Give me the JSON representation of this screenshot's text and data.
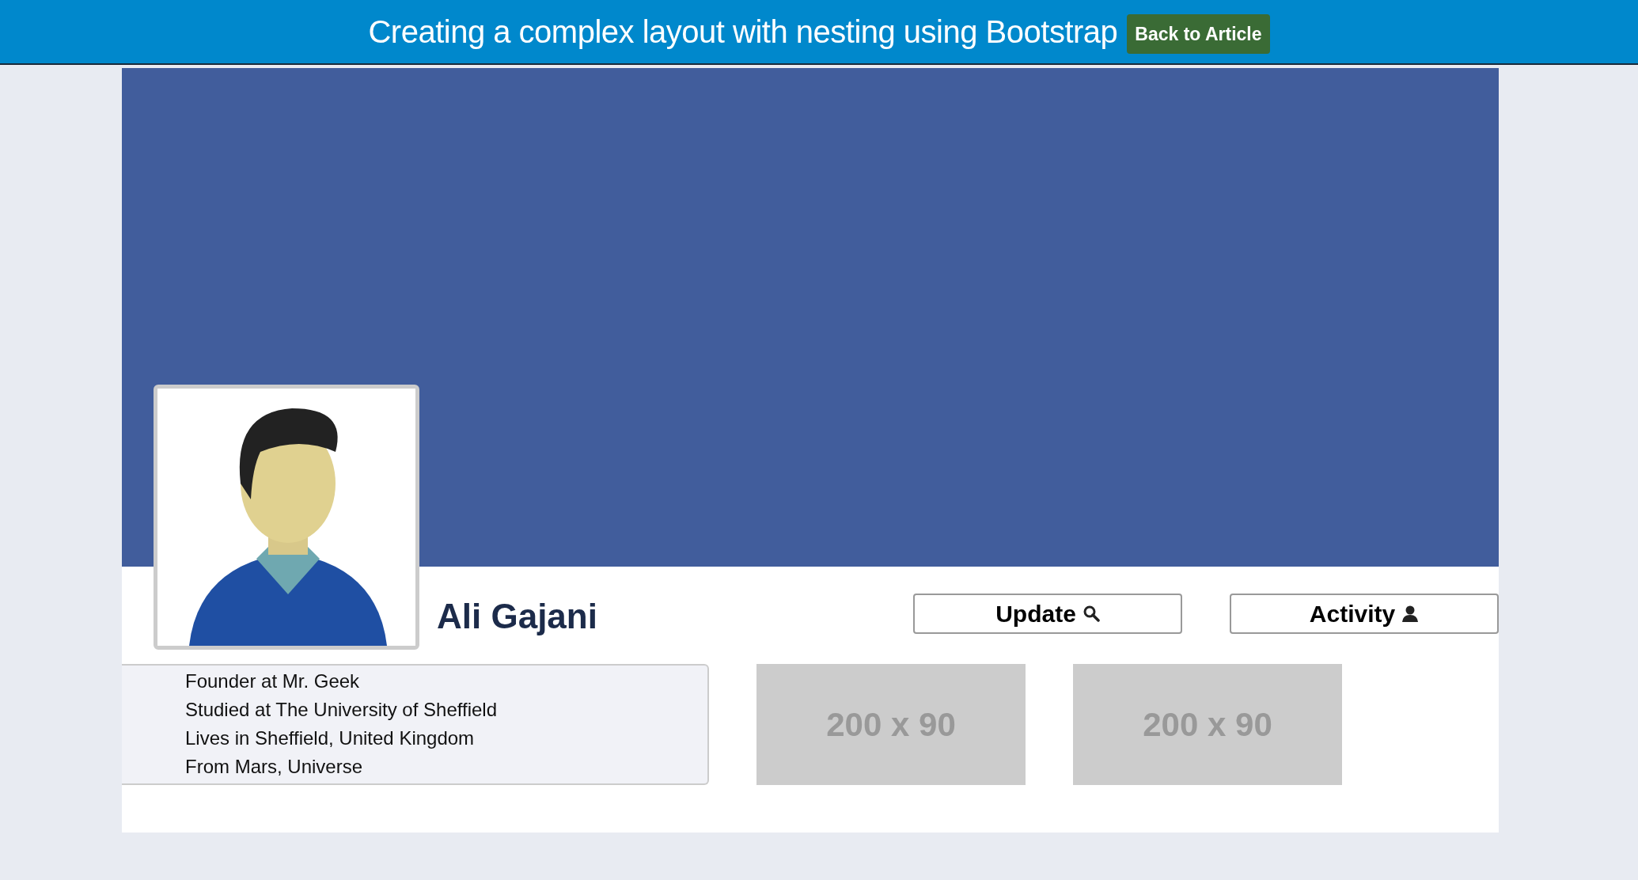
{
  "header": {
    "title": "Creating a complex layout with nesting using Bootstrap",
    "back_button": "Back to Article"
  },
  "profile": {
    "name": "Ali Gajani",
    "actions": [
      {
        "label": "Update",
        "kind": "search"
      },
      {
        "label": "Activity",
        "kind": "person"
      }
    ]
  },
  "about": [
    "Founder at Mr. Geek",
    "Studied at The University of Sheffield",
    "Lives in Sheffield, United Kingdom",
    "From Mars, Universe"
  ],
  "placeholders": [
    "200 x 90",
    "200 x 90"
  ]
}
